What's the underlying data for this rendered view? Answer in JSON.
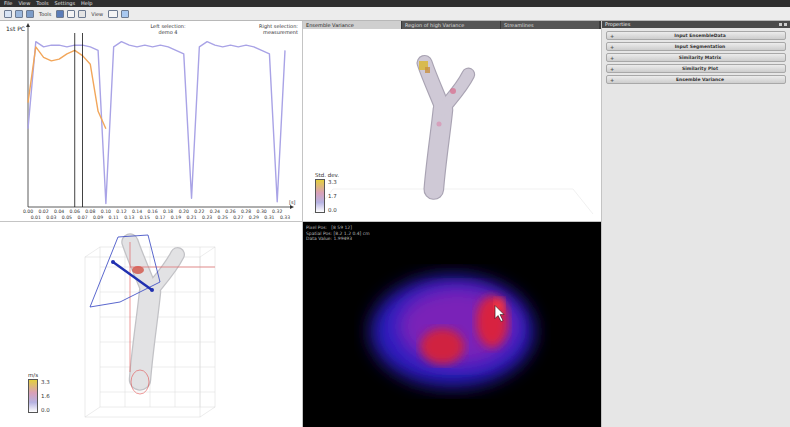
{
  "menu": [
    "File",
    "View",
    "Tools",
    "Settings",
    "Help"
  ],
  "toolbar": {
    "labels": [
      "Tools",
      "View"
    ]
  },
  "chart": {
    "y_label": "1st PC",
    "left_selection": {
      "label": "Left selection:",
      "name": "demo 4"
    },
    "right_selection": {
      "label": "Right selection:",
      "name": "measurement"
    },
    "x_unit": "[s]",
    "x_ticks_top": [
      "0.00",
      "0.02",
      "0.04",
      "0.06",
      "0.08",
      "0.10",
      "0.12",
      "0.14",
      "0.16",
      "0.18",
      "0.20",
      "0.22",
      "0.24",
      "0.26",
      "0.28",
      "0.30",
      "0.32"
    ],
    "x_ticks_bottom": [
      "0.01",
      "0.03",
      "0.05",
      "0.07",
      "0.09",
      "0.11",
      "0.13",
      "0.15",
      "0.17",
      "0.19",
      "0.21",
      "0.23",
      "0.25",
      "0.27",
      "0.29",
      "0.31",
      "0.33"
    ],
    "selection_lines": [
      0.06,
      0.07
    ],
    "series": [
      {
        "name": "measurement",
        "color": "#a9a3e6",
        "values": [
          0.45,
          0.95,
          0.92,
          0.93,
          0.93,
          0.92,
          0.93,
          0.93,
          0.92,
          0.9,
          0.02,
          0.92,
          0.95,
          0.93,
          0.92,
          0.93,
          0.92,
          0.93,
          0.92,
          0.9,
          0.88,
          0.05,
          0.92,
          0.95,
          0.93,
          0.92,
          0.93,
          0.92,
          0.93,
          0.92,
          0.9,
          0.88,
          0.03,
          0.9
        ]
      },
      {
        "name": "demo 4",
        "color": "#f2a65a",
        "values": [
          0.6,
          0.92,
          0.86,
          0.84,
          0.85,
          0.88,
          0.9,
          0.87,
          0.82,
          0.55,
          0.45
        ]
      }
    ]
  },
  "velocity_view": {
    "legend_title": "m/s",
    "legend_ticks": [
      "3.3",
      "1.6",
      "0.0"
    ]
  },
  "tabs": [
    {
      "label": "Ensemble Variance",
      "selected": true
    },
    {
      "label": "Region of high Variance",
      "selected": false
    },
    {
      "label": "Streamlines",
      "selected": false
    }
  ],
  "variance_view": {
    "legend_title": "Std. dev.",
    "legend_ticks": [
      "3.3",
      "1.7",
      "0.0"
    ]
  },
  "slice_view": {
    "info": [
      "Pixel Pos:   [8 59 12]",
      "Spatial Pos: [8.2 1.2 0.4] cm",
      "Data Value: 1.99493"
    ]
  },
  "properties": {
    "title": "Properties",
    "collapsed_icon": "+",
    "sections": [
      {
        "label": "Input EnsembleData",
        "expanded": false
      },
      {
        "label": "Input Segmentation",
        "expanded": false
      },
      {
        "label": "Similarity Matrix",
        "expanded": false
      },
      {
        "label": "Similarity Plot",
        "expanded": false
      },
      {
        "label": "Ensemble Variance",
        "expanded": false
      }
    ]
  }
}
